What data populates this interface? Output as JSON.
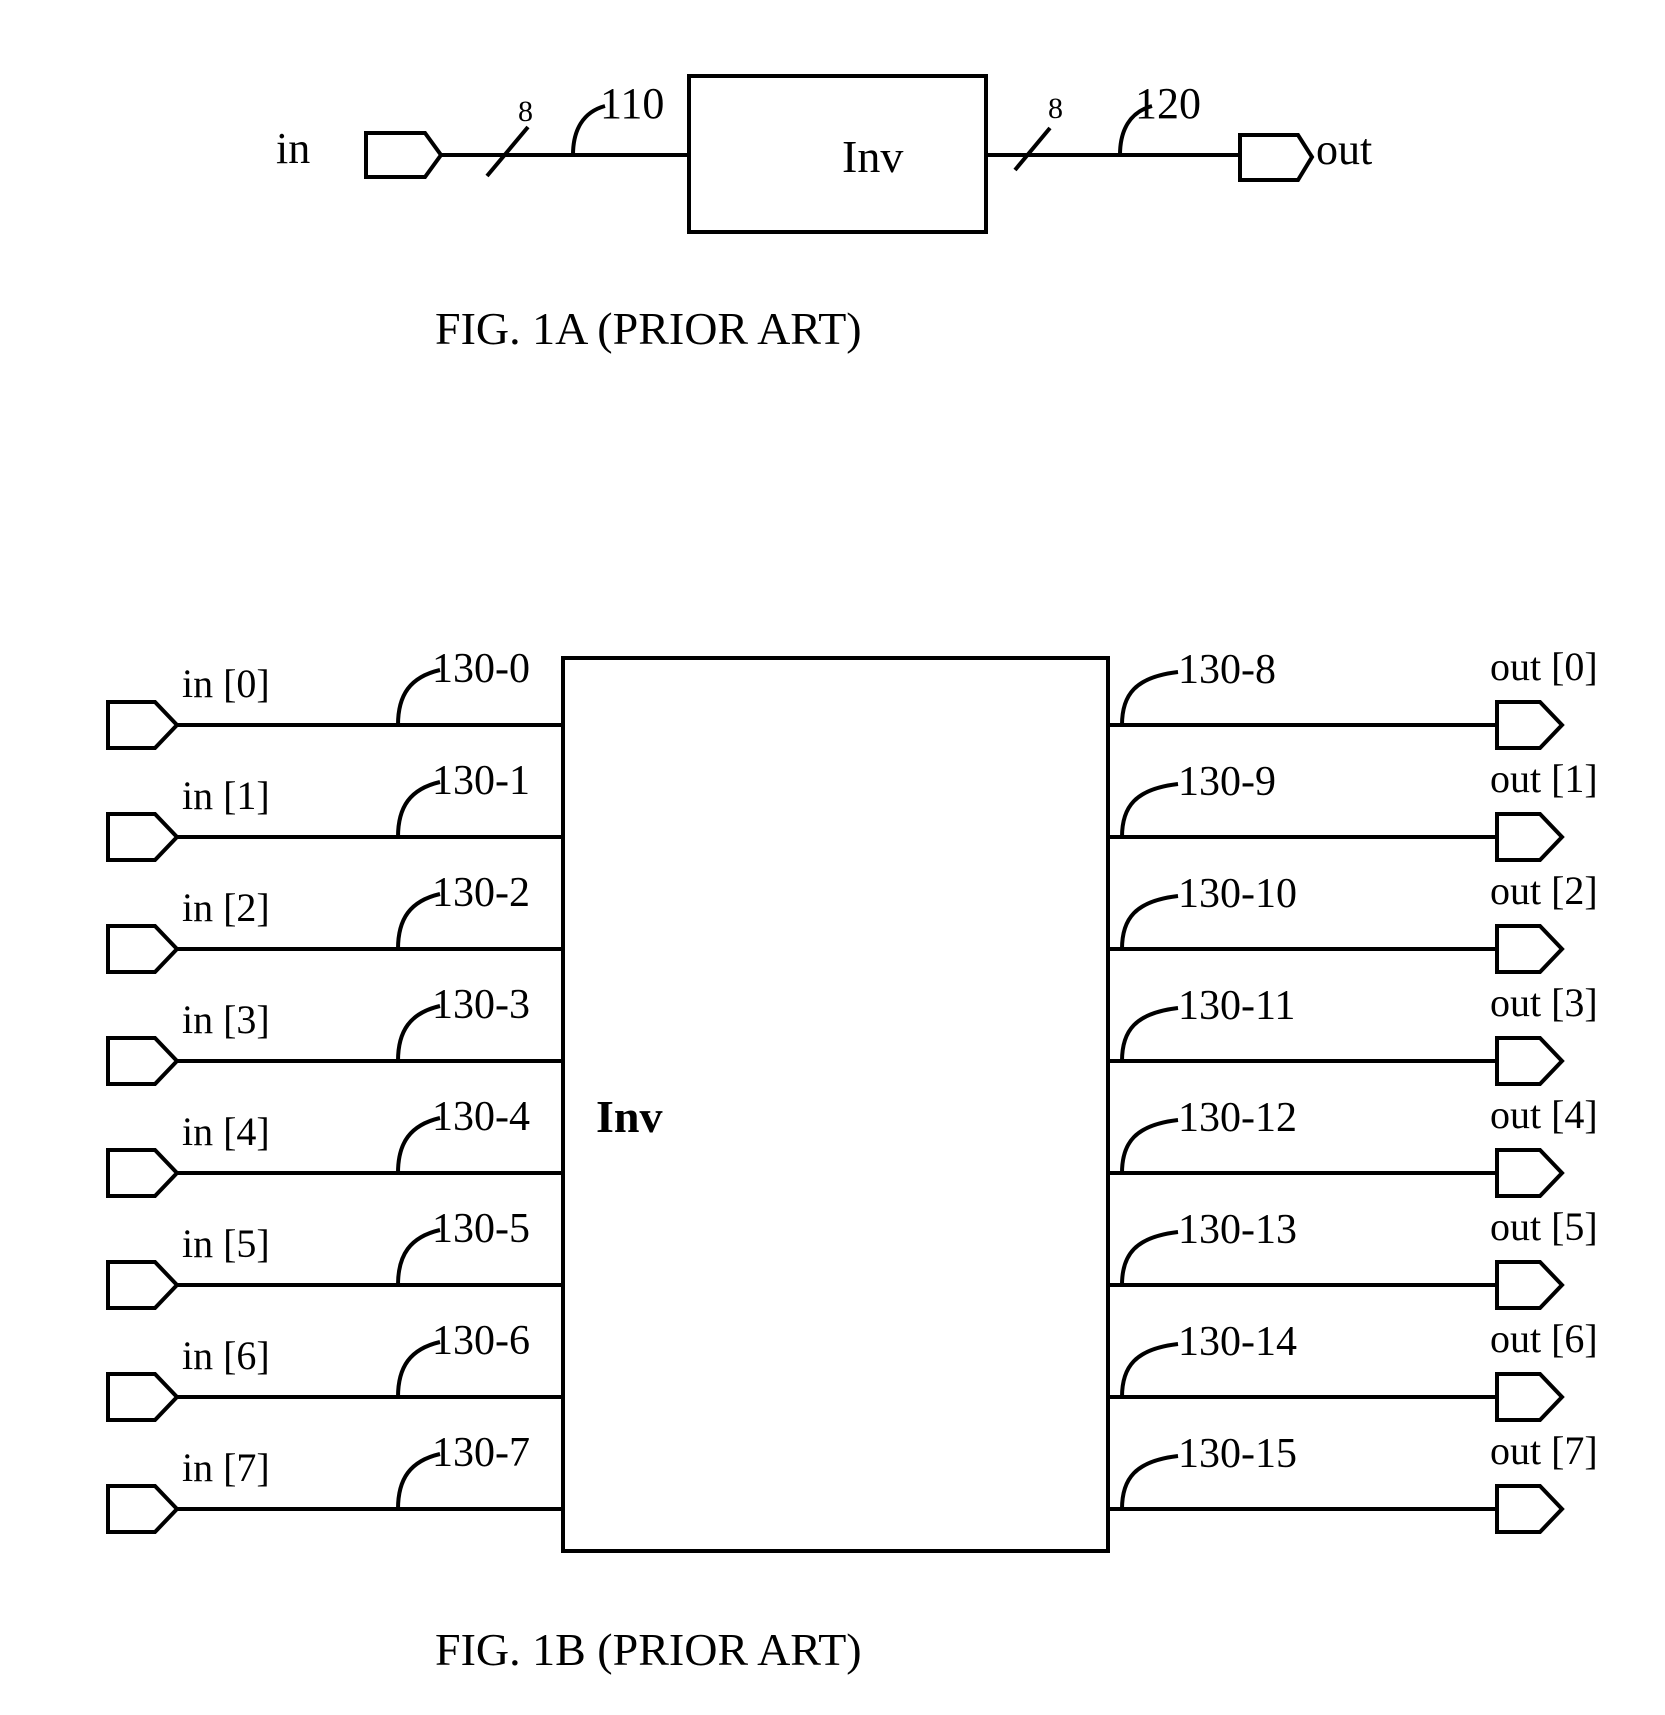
{
  "fig1a": {
    "caption": "FIG. 1A (PRIOR ART)",
    "input_label": "in",
    "output_label": "out",
    "block_label": "Inv",
    "bus_width_in": "8",
    "bus_width_out": "8",
    "input_ref": "110",
    "output_ref": "120"
  },
  "fig1b": {
    "caption": "FIG. 1B (PRIOR ART)",
    "block_label": "Inv",
    "inputs": [
      {
        "label": "in [0]",
        "ref": "130-0"
      },
      {
        "label": "in [1]",
        "ref": "130-1"
      },
      {
        "label": "in [2]",
        "ref": "130-2"
      },
      {
        "label": "in [3]",
        "ref": "130-3"
      },
      {
        "label": "in [4]",
        "ref": "130-4"
      },
      {
        "label": "in [5]",
        "ref": "130-5"
      },
      {
        "label": "in [6]",
        "ref": "130-6"
      },
      {
        "label": "in [7]",
        "ref": "130-7"
      }
    ],
    "outputs": [
      {
        "label": "out [0]",
        "ref": "130-8"
      },
      {
        "label": "out [1]",
        "ref": "130-9"
      },
      {
        "label": "out [2]",
        "ref": "130-10"
      },
      {
        "label": "out [3]",
        "ref": "130-11"
      },
      {
        "label": "out [4]",
        "ref": "130-12"
      },
      {
        "label": "out [5]",
        "ref": "130-13"
      },
      {
        "label": "out [6]",
        "ref": "130-14"
      },
      {
        "label": "out [7]",
        "ref": "130-15"
      }
    ]
  }
}
